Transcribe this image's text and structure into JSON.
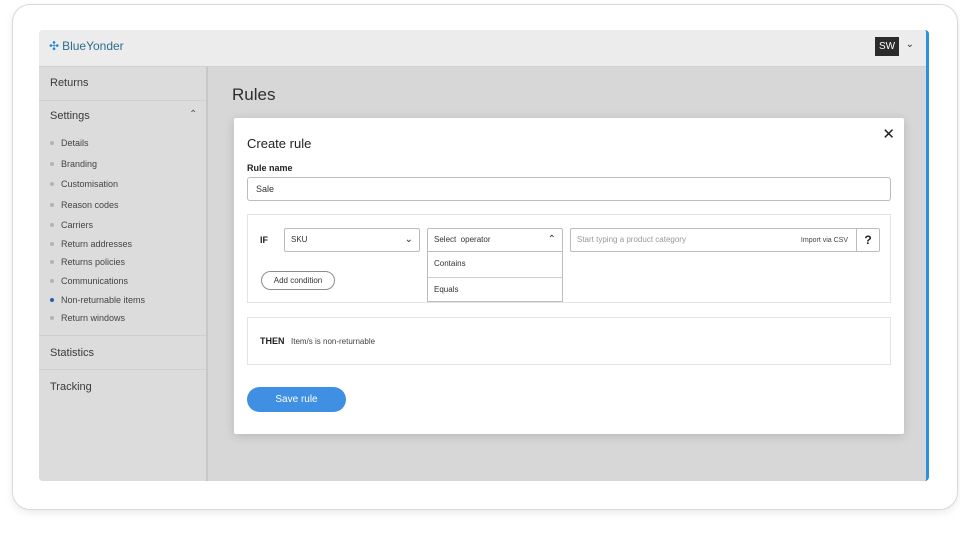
{
  "brand": {
    "logo_text": "BlueYonder",
    "logo_icon": "blueyonder-mark-icon",
    "accent": "#3f8fe3"
  },
  "user": {
    "initials": "SW"
  },
  "sidebar": {
    "returns_label": "Returns",
    "settings_label": "Settings",
    "settings_items": [
      {
        "label": "Details"
      },
      {
        "label": "Branding"
      },
      {
        "label": "Customisation"
      },
      {
        "label": "Reason codes"
      },
      {
        "label": "Carriers"
      },
      {
        "label": "Return addresses"
      },
      {
        "label": "Returns policies"
      },
      {
        "label": "Communications"
      },
      {
        "label": "Non-returnable items"
      },
      {
        "label": "Return windows"
      }
    ],
    "active_item": "Non-returnable items",
    "statistics_label": "Statistics",
    "tracking_label": "Tracking"
  },
  "page": {
    "title": "Rules"
  },
  "modal": {
    "title": "Create rule",
    "rule_name_label": "Rule name",
    "rule_name_value": "Sale",
    "if_label": "IF",
    "field_select_value": "SKU",
    "operator_select_value": "Select  operator",
    "operator_options": [
      "Contains",
      "Equals"
    ],
    "category_placeholder": "Start typing a product category",
    "import_csv_label": "Import via CSV",
    "help_label": "?",
    "add_condition_label": "Add condition",
    "then_label": "THEN",
    "then_text": "Item/s is non-returnable",
    "save_label": "Save rule"
  }
}
